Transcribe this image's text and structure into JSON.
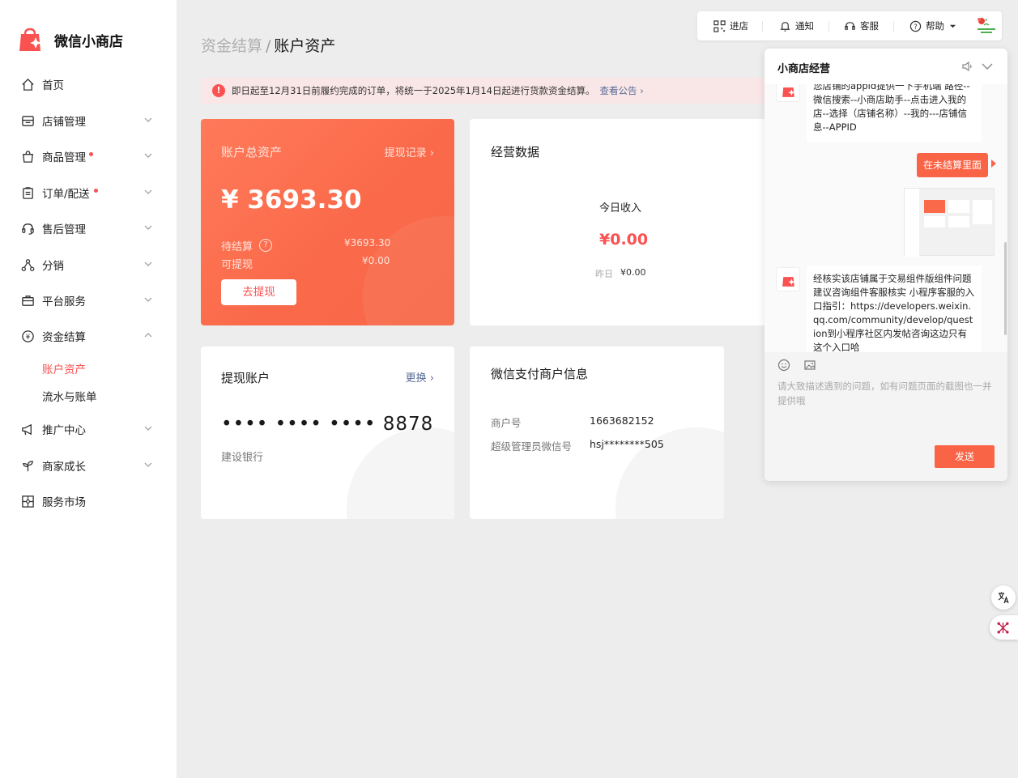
{
  "app": {
    "name": "微信小商店",
    "brand_color": "#fa5151"
  },
  "sidebar": {
    "items": [
      {
        "label": "首页",
        "icon": "home-icon"
      },
      {
        "label": "店铺管理",
        "icon": "store-icon"
      },
      {
        "label": "商品管理",
        "icon": "bag-icon",
        "dot": true
      },
      {
        "label": "订单/配送",
        "icon": "clipboard-icon",
        "dot": true
      },
      {
        "label": "售后管理",
        "icon": "headset-icon"
      },
      {
        "label": "分销",
        "icon": "share-icon"
      },
      {
        "label": "平台服务",
        "icon": "briefcase-icon"
      },
      {
        "label": "资金结算",
        "icon": "yuan-icon",
        "expanded": true
      },
      {
        "label": "推广中心",
        "icon": "megaphone-icon"
      },
      {
        "label": "商家成长",
        "icon": "sprout-icon"
      },
      {
        "label": "服务市场",
        "icon": "puzzle-icon"
      }
    ],
    "sub_items": [
      {
        "label": "账户资产",
        "active": true
      },
      {
        "label": "流水与账单"
      }
    ]
  },
  "breadcrumb": {
    "parent": "资金结算",
    "separator": "/",
    "current": "账户资产"
  },
  "notice": {
    "icon": "!",
    "text": "即日起至12月31日前履约完成的订单，将统一于2025年1月14日起进行货款资金结算。",
    "link": "查看公告"
  },
  "asset_card": {
    "title": "账户总资产",
    "records_link": "提现记录",
    "amount": "¥ 3693.30",
    "pending_label": "待结算",
    "pending_value": "¥3693.30",
    "withdrawable_label": "可提现",
    "withdrawable_value": "¥0.00",
    "withdraw_button": "去提现"
  },
  "business_card": {
    "title": "经营数据",
    "today_label": "今日收入",
    "today_value": "¥0.00",
    "yesterday_label": "昨日",
    "yesterday_value": "¥0.00"
  },
  "withdraw_account": {
    "title": "提现账户",
    "change_link": "更换",
    "masked_number": "•••• •••• •••• 8878",
    "bank": "建设银行"
  },
  "merchant_info": {
    "title": "微信支付商户信息",
    "merchant_id_label": "商户号",
    "merchant_id": "1663682152",
    "admin_wechat_label": "超级管理员微信号",
    "admin_wechat": "hsj********505"
  },
  "toolbar": {
    "enter_store": "进店",
    "notifications": "通知",
    "support": "客服",
    "help": "帮助"
  },
  "chat": {
    "title": "小商店经营",
    "messages": [
      {
        "from": "bot",
        "text": "您店铺的appid提供一下手机端 路径--微信搜索--小商店助手--点击进入我的店--选择（店铺名称）--我的---店铺信息--APPID"
      },
      {
        "from": "me",
        "text": "在未结算里面"
      },
      {
        "from": "me",
        "type": "image"
      },
      {
        "from": "bot",
        "text": "经核实该店铺属于交易组件版组件问题建议咨询组件客服核实  小程序客服的入口指引：https://developers.weixin.qq.com/community/develop/question到小程序社区内发帖咨询这边只有这个入口哈"
      }
    ],
    "input_placeholder": "请大致描述遇到的问题，如有问题页面的截图也一并提供哦",
    "send_button": "发送"
  }
}
